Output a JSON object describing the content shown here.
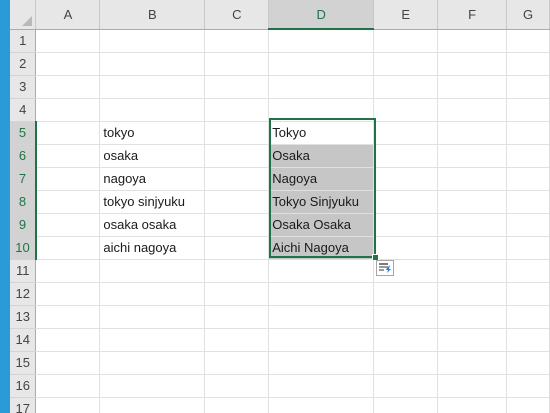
{
  "sheet": {
    "column_headers": [
      "A",
      "B",
      "C",
      "D",
      "E",
      "F",
      "G"
    ],
    "row_headers": [
      "1",
      "2",
      "3",
      "4",
      "5",
      "6",
      "7",
      "8",
      "9",
      "10",
      "11",
      "12",
      "13",
      "14",
      "15",
      "16",
      "17"
    ],
    "cells": {
      "B5": "tokyo",
      "B6": "osaka",
      "B7": "nagoya",
      "B8": "tokyo sinjyuku",
      "B9": "osaka osaka",
      "B10": "aichi nagoya",
      "D5": "Tokyo",
      "D6": "Osaka",
      "D7": "Nagoya",
      "D8": "Tokyo Sinjyuku",
      "D9": "Osaka Osaka",
      "D10": "Aichi Nagoya"
    },
    "selection": {
      "range": "D5:D10",
      "active_cell": "D5"
    }
  },
  "icons": {
    "select_all": "select-all-triangle-icon",
    "flash_fill": "flash-fill-options-icon"
  },
  "colors": {
    "selection_border": "#217346",
    "selection_fill": "#c6c6c6",
    "left_strip": "#2b9bd8"
  }
}
